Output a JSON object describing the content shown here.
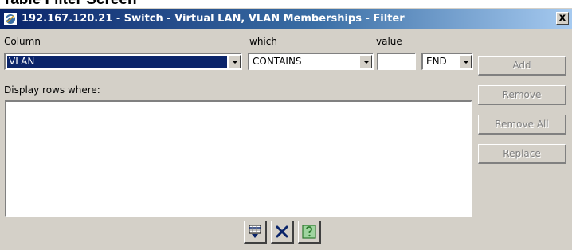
{
  "page": {
    "caption": "Table Filter Screen"
  },
  "window": {
    "title": "192.167.120.21 - Switch - Virtual LAN, VLAN Memberships - Filter",
    "close_glyph": "x"
  },
  "form": {
    "column_label": "Column",
    "which_label": "which",
    "value_label": "value",
    "column_value": "VLAN",
    "which_value": "CONTAINS",
    "value_text": "",
    "end_value": "END",
    "display_rows_label": "Display rows where:"
  },
  "buttons": {
    "add": "Add",
    "remove": "Remove",
    "remove_all": "Remove All",
    "replace": "Replace"
  },
  "icons": {
    "apply": "apply-filter-icon",
    "cancel": "cancel-icon",
    "help": "help-icon"
  },
  "colors": {
    "titlebar_start": "#0a246a",
    "titlebar_end": "#a6caf0",
    "dialog_bg": "#d4d0c8",
    "cancel_x": "#0a246a",
    "help_green": "#3f9a3f"
  }
}
